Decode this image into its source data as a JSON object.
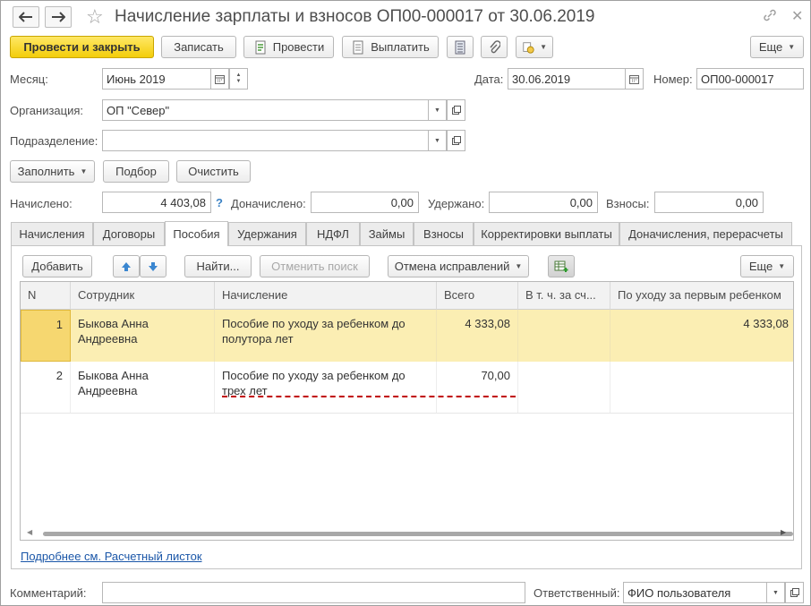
{
  "window": {
    "title": "Начисление зарплаты и взносов ОП00-000017 от 30.06.2019"
  },
  "toolbar": {
    "post_close": "Провести и закрыть",
    "save": "Записать",
    "post": "Провести",
    "pay": "Выплатить",
    "more": "Еще"
  },
  "header": {
    "month_label": "Месяц:",
    "month_value": "Июнь 2019",
    "date_label": "Дата:",
    "date_value": "30.06.2019",
    "number_label": "Номер:",
    "number_value": "ОП00-000017",
    "org_label": "Организация:",
    "org_value": "ОП \"Север\"",
    "dept_label": "Подразделение:",
    "dept_value": ""
  },
  "actions": {
    "fill": "Заполнить",
    "select": "Подбор",
    "clear": "Очистить"
  },
  "totals": {
    "accrued_label": "Начислено:",
    "accrued_value": "4 403,08",
    "help": "?",
    "extra_label": "Доначислено:",
    "extra_value": "0,00",
    "withheld_label": "Удержано:",
    "withheld_value": "0,00",
    "contrib_label": "Взносы:",
    "contrib_value": "0,00"
  },
  "tabs": [
    {
      "label": "Начисления"
    },
    {
      "label": "Договоры"
    },
    {
      "label": "Пособия"
    },
    {
      "label": "Удержания"
    },
    {
      "label": "НДФЛ"
    },
    {
      "label": "Займы"
    },
    {
      "label": "Взносы"
    },
    {
      "label": "Корректировки выплаты"
    },
    {
      "label": "Доначисления, перерасчеты"
    }
  ],
  "table_toolbar": {
    "add": "Добавить",
    "find": "Найти...",
    "cancel_search": "Отменить поиск",
    "cancel_corrections": "Отмена исправлений",
    "more": "Еще"
  },
  "table": {
    "columns": [
      "N",
      "Сотрудник",
      "Начисление",
      "Всего",
      "В т. ч. за сч...",
      "По уходу за первым ребенком"
    ],
    "rows": [
      {
        "n": "1",
        "employee": "Быкова Анна Андреевна",
        "accrual": "Пособие по уходу за ребенком до полутора лет",
        "total": "4 333,08",
        "incl": "",
        "first_child": "4 333,08"
      },
      {
        "n": "2",
        "employee": "Быкова Анна Андреевна",
        "accrual": "Пособие по уходу за ребенком до трех лет",
        "total": "70,00",
        "incl": "",
        "first_child": ""
      }
    ]
  },
  "footer": {
    "payslip_link": "Подробнее см. Расчетный листок",
    "comment_label": "Комментарий:",
    "comment_value": "",
    "responsible_label": "Ответственный:",
    "responsible_value": "ФИО пользователя"
  },
  "colors": {
    "primary_button": "#f3cd0a",
    "selected_row": "#fbeeb3",
    "selected_cell": "#f6d770",
    "link": "#1a56a8",
    "error_underline": "#c00000"
  }
}
